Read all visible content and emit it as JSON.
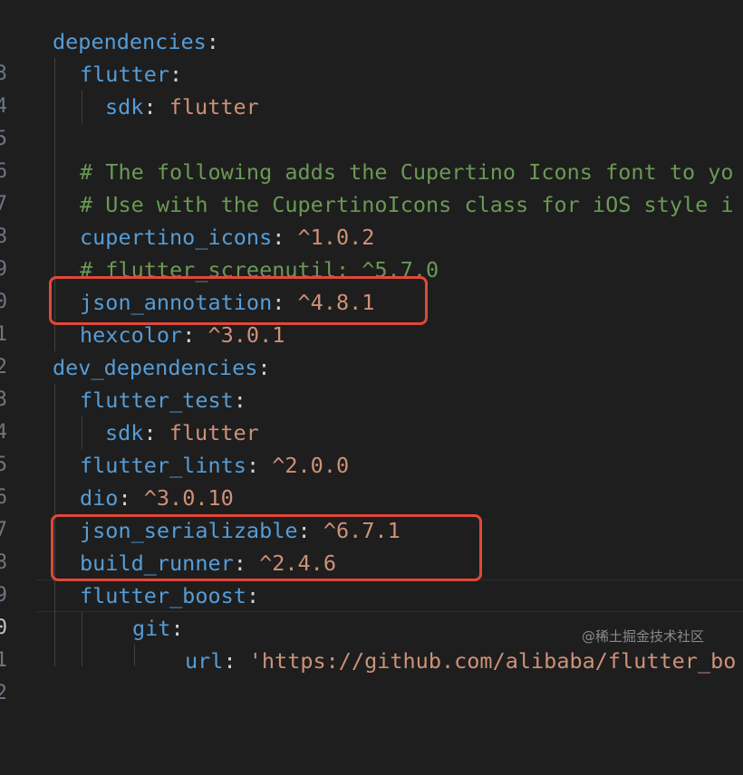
{
  "line_numbers": [
    "3",
    "4",
    "5",
    "6",
    "7",
    "8",
    "9",
    "0",
    "1",
    "2",
    "3",
    "4",
    "5",
    "6",
    "7",
    "8",
    "9",
    "0",
    "1",
    "2"
  ],
  "lines": [
    {
      "key": "dependencies",
      "sep": ":",
      "value": ""
    },
    {
      "key": "flutter",
      "sep": ":",
      "value": ""
    },
    {
      "key": "sdk",
      "sep": ":",
      "value": " flutter"
    },
    {
      "key": "",
      "sep": "",
      "value": ""
    },
    {
      "comment": "# The following adds the Cupertino Icons font to yo"
    },
    {
      "comment": "# Use with the CupertinoIcons class for iOS style i"
    },
    {
      "key": "cupertino_icons",
      "sep": ":",
      "value": " ^1.0.2"
    },
    {
      "comment": "# flutter_screenutil: ^5.7.0"
    },
    {
      "key": "json_annotation",
      "sep": ":",
      "value": " ^4.8.1"
    },
    {
      "key": "hexcolor",
      "sep": ":",
      "value": " ^3.0.1"
    },
    {
      "key": "dev_dependencies",
      "sep": ":",
      "value": ""
    },
    {
      "key": "flutter_test",
      "sep": ":",
      "value": ""
    },
    {
      "key": "sdk",
      "sep": ":",
      "value": " flutter"
    },
    {
      "key": "flutter_lints",
      "sep": ":",
      "value": " ^2.0.0"
    },
    {
      "key": "dio",
      "sep": ":",
      "value": " ^3.0.10"
    },
    {
      "key": "json_serializable",
      "sep": ":",
      "value": " ^6.7.1"
    },
    {
      "key": "build_runner",
      "sep": ":",
      "value": " ^2.4.6"
    },
    {
      "key": "flutter_boost",
      "sep": ":",
      "value": ""
    },
    {
      "key": "git",
      "sep": ":",
      "value": ""
    },
    {
      "key": "url",
      "sep": ":",
      "value": " 'https://github.com/alibaba/flutter_bo"
    }
  ],
  "watermark": "@稀土掘金技术社区",
  "colors": {
    "background": "#1e1e1e",
    "key": "#569cd6",
    "string": "#ce9178",
    "comment": "#6a9955",
    "highlight_box": "#e0483a"
  }
}
